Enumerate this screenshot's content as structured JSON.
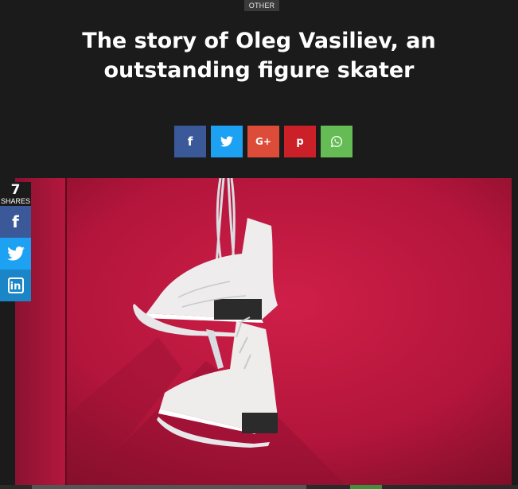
{
  "article": {
    "category": "OTHER",
    "title": "The story of Oleg Vasiliev, an outstanding figure skater"
  },
  "share_bar": {
    "buttons": [
      {
        "name": "facebook",
        "glyph": "f",
        "color": "#3b5998"
      },
      {
        "name": "twitter",
        "glyph": "bird",
        "color": "#1da1f2"
      },
      {
        "name": "google-plus",
        "glyph": "G+",
        "color": "#dd4b39"
      },
      {
        "name": "pinterest",
        "glyph": "p",
        "color": "#cb2027"
      },
      {
        "name": "whatsapp",
        "glyph": "whatsapp",
        "color": "#65bc54"
      }
    ]
  },
  "side_share": {
    "count": "7",
    "count_label": "SHARES",
    "buttons": [
      {
        "name": "facebook",
        "glyph": "f",
        "color": "#3b5998"
      },
      {
        "name": "twitter",
        "glyph": "bird",
        "color": "#1da1f2"
      },
      {
        "name": "linkedin",
        "glyph": "in",
        "color": "#1a86c7"
      }
    ]
  },
  "hero_image": {
    "subject": "white figure skates hanging on a red wall",
    "background_color": "#b4173a"
  }
}
